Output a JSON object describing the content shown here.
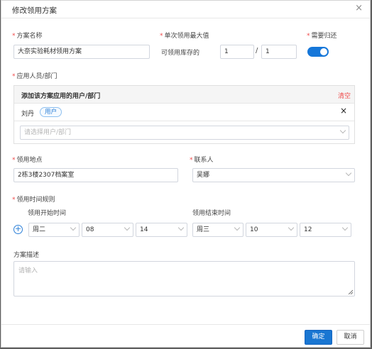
{
  "dialog": {
    "title": "修改领用方案",
    "close_glyph": "×"
  },
  "form": {
    "plan_name": {
      "label": "方案名称",
      "value": "大奈实验耗材领用方案"
    },
    "max_single": {
      "label": "单次领用最大值",
      "stock_label": "可领用库存的",
      "numerator": "1",
      "separator": "/",
      "denominator": "1"
    },
    "need_return": {
      "label": "需要归还",
      "enabled": true
    },
    "applies_to": {
      "label": "应用人员/部门",
      "box_title": "添加该方案应用的用户/部门",
      "clear_label": "清空",
      "users": [
        {
          "name": "刘丹",
          "type": "用户",
          "remove_glyph": "×"
        }
      ],
      "select_placeholder": "请选择用户/部门"
    },
    "location": {
      "label": "领用地点",
      "value": "2栋3楼2307档案室"
    },
    "contact": {
      "label": "联系人",
      "value": "吴娜"
    },
    "time_rule": {
      "label": "领用时间规则",
      "start_label": "领用开始时间",
      "end_label": "领用结束时间",
      "start": {
        "day": "周二",
        "hour": "08",
        "minute": "14"
      },
      "end": {
        "day": "周三",
        "hour": "10",
        "minute": "12"
      }
    },
    "description": {
      "label": "方案描述",
      "placeholder": "请输入"
    }
  },
  "footer": {
    "confirm_label": "确定",
    "cancel_label": "取消"
  },
  "colors": {
    "primary": "#1976d2",
    "required": "#f04a4a",
    "clear": "#ee4a4a",
    "badge": "#2b7fd6"
  },
  "icons": [
    "close-icon",
    "remove-user-icon",
    "chevron-down-icon",
    "add-time-rule-icon",
    "resize-grip-icon"
  ]
}
